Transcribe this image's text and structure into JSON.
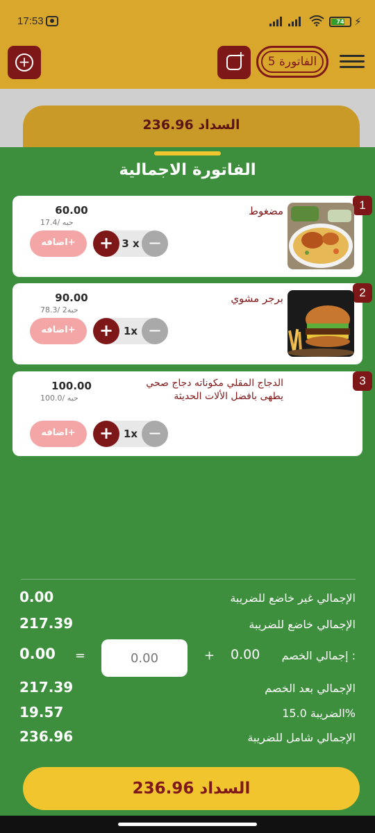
{
  "status_bar": {
    "time": "17:53",
    "battery": "74"
  },
  "header": {
    "invoice_label": "الفاتورة 5"
  },
  "top_pay": {
    "label": "السداد 236.96"
  },
  "sheet": {
    "title": "الفاتورة الاجمالية"
  },
  "items": [
    {
      "number": "1",
      "name": "مضغوط",
      "price": "60.00",
      "unit": "17.4/ حبه",
      "qty": "3 x",
      "add_label": "اضافه+",
      "image": "kabsa-chicken-rice-image"
    },
    {
      "number": "2",
      "name": "برجر مشوي",
      "price": "90.00",
      "unit": "78.3/ حبه2",
      "qty": "1x",
      "add_label": "اضافه+",
      "image": "burger-fries-image"
    },
    {
      "number": "3",
      "name": "الدجاج المقلي مكوناته دجاج صحي يطهى بافضل الألات الحديثة",
      "price": "100.00",
      "unit": "100.0/ حبه",
      "qty": "1x",
      "add_label": "اضافه+"
    }
  ],
  "summary": {
    "non_taxable_label": "الإجمالي غير خاضع للضريبة",
    "non_taxable_value": "0.00",
    "taxable_label": "الإجمالي خاضع للضريبة",
    "taxable_value": "217.39",
    "discount_label": "إجمالي الخصم :",
    "discount_value": "0.00",
    "discount_plus": "+",
    "discount_input_placeholder": "0.00",
    "discount_eq": "=",
    "discount_result": "0.00",
    "after_discount_label": "الإجمالي بعد الخصم",
    "after_discount_value": "217.39",
    "tax_label": "الضريبة 15.0%",
    "tax_value": "19.57",
    "total_label": "الإجمالي شامل للضريبة",
    "total_value": "236.96"
  },
  "pay_button": {
    "label": "السداد  236.96"
  },
  "colors": {
    "header": "#d9a72c",
    "sheet": "#3d8f3d",
    "accent": "#7e1717",
    "pay": "#f0c52e"
  }
}
